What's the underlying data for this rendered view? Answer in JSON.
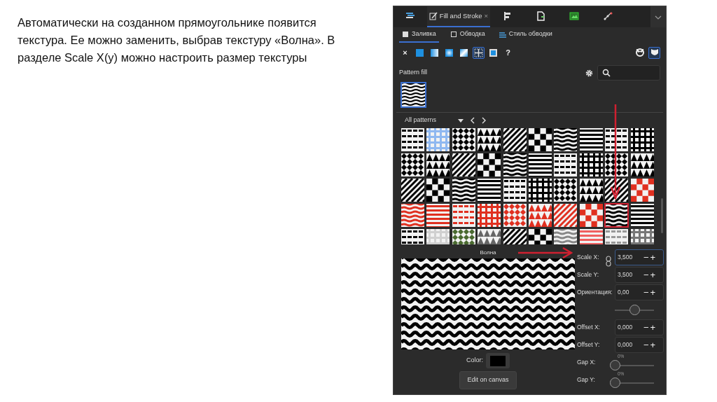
{
  "slide": {
    "text": "Автоматически на созданном прямоугольнике появится текстура. Ее можно заменить, выбрав текстуру «Волна». В разделе Scale X(y) можно настроить размер текстуры"
  },
  "dock_tabs": [
    {
      "kind": "icon",
      "selected": false
    },
    {
      "kind": "label",
      "label": "Fill and Stroke",
      "close": "×",
      "selected": true
    },
    {
      "kind": "icon",
      "selected": false
    },
    {
      "kind": "icon",
      "selected": false
    },
    {
      "kind": "icon",
      "selected": false
    },
    {
      "kind": "icon",
      "selected": false
    }
  ],
  "sub_tabs": [
    {
      "label": "Заливка",
      "selected": true
    },
    {
      "label": "Обводка",
      "selected": false
    },
    {
      "label": "Стиль обводки",
      "selected": false
    }
  ],
  "fill_types": [
    {
      "kind": "none",
      "text": "×",
      "selected": false
    },
    {
      "kind": "flat",
      "selected": false
    },
    {
      "kind": "linear",
      "selected": false
    },
    {
      "kind": "radial",
      "selected": false
    },
    {
      "kind": "mesh",
      "selected": false
    },
    {
      "kind": "pattern",
      "selected": true
    },
    {
      "kind": "swatch",
      "selected": false
    },
    {
      "kind": "unset",
      "text": "?",
      "selected": false
    }
  ],
  "fill_rules": [
    {
      "selected": false
    },
    {
      "selected": true
    }
  ],
  "pattern_fill": {
    "title": "Pattern fill"
  },
  "collection": "All patterns",
  "tiles": [
    {
      "color": "#000000",
      "selected": false
    },
    {
      "color": "#8fb8f0",
      "selected": false
    },
    {
      "color": "#000000",
      "selected": false
    },
    {
      "color": "#000000",
      "selected": false
    },
    {
      "color": "#000000",
      "selected": false
    },
    {
      "color": "#000000",
      "selected": false
    },
    {
      "color": "#000000",
      "selected": false
    },
    {
      "color": "#000000",
      "selected": false
    },
    {
      "color": "#000000",
      "selected": false
    },
    {
      "color": "#000000",
      "selected": false
    },
    {
      "color": "#000000",
      "selected": false
    },
    {
      "color": "#000000",
      "selected": false
    },
    {
      "color": "#000000",
      "selected": false
    },
    {
      "color": "#000000",
      "selected": false
    },
    {
      "color": "#000000",
      "selected": false
    },
    {
      "color": "#000000",
      "selected": false
    },
    {
      "color": "#000000",
      "selected": false
    },
    {
      "color": "#000000",
      "selected": false
    },
    {
      "color": "#000000",
      "selected": false
    },
    {
      "color": "#000000",
      "selected": false
    },
    {
      "color": "#000000",
      "selected": false
    },
    {
      "color": "#000000",
      "selected": false
    },
    {
      "color": "#000000",
      "selected": false
    },
    {
      "color": "#000000",
      "selected": false
    },
    {
      "color": "#000000",
      "selected": false
    },
    {
      "color": "#000000",
      "selected": false
    },
    {
      "color": "#000000",
      "selected": false
    },
    {
      "color": "#000000",
      "selected": false
    },
    {
      "color": "#000000",
      "selected": false
    },
    {
      "color": "#e03020",
      "selected": false
    },
    {
      "color": "#e03020",
      "selected": false
    },
    {
      "color": "#e03020",
      "selected": false
    },
    {
      "color": "#e03020",
      "selected": false
    },
    {
      "color": "#e03020",
      "selected": false
    },
    {
      "color": "#e03020",
      "selected": false
    },
    {
      "color": "#e03020",
      "selected": false
    },
    {
      "color": "#e03020",
      "selected": false
    },
    {
      "color": "#e03020",
      "selected": false
    },
    {
      "color": "#000000",
      "selected": true
    },
    {
      "color": "#000000",
      "selected": false
    },
    {
      "color": "#000000",
      "selected": false
    },
    {
      "color": "#d0d0d0",
      "selected": false
    },
    {
      "color": "#4a6a30",
      "selected": false
    },
    {
      "color": "#666666",
      "selected": false
    },
    {
      "color": "#000000",
      "selected": false
    },
    {
      "color": "#000000",
      "selected": false
    },
    {
      "color": "#888888",
      "selected": false
    },
    {
      "color": "#f06060",
      "selected": false
    },
    {
      "color": "#999999",
      "selected": false
    },
    {
      "color": "#777777",
      "selected": false
    }
  ],
  "selected_name": "Волна",
  "properties": [
    {
      "kind": "spin",
      "label": "Scale X:",
      "value": "3,500",
      "minus": "−",
      "plus": "+",
      "focused": true
    },
    {
      "kind": "spin",
      "label": "Scale Y:",
      "value": "3,500",
      "minus": "−",
      "plus": "+",
      "focused": false
    },
    {
      "kind": "spin",
      "label": "Ориентация:",
      "value": "0,00",
      "minus": "−",
      "plus": "+",
      "focused": false
    },
    {
      "kind": "slider",
      "level": 0.5
    },
    {
      "kind": "spin",
      "label": "Offset X:",
      "value": "0,000",
      "minus": "−",
      "plus": "+",
      "focused": false
    },
    {
      "kind": "spin",
      "label": "Offset Y:",
      "value": "0,000",
      "minus": "−",
      "plus": "+",
      "focused": false
    },
    {
      "kind": "gap",
      "label": "Gap X:",
      "reading": "0%",
      "level": 0
    },
    {
      "kind": "gap",
      "label": "Gap Y:",
      "reading": "0%",
      "level": 0
    }
  ],
  "color": {
    "label": "Color:"
  },
  "edit_button": "Edit on canvas"
}
